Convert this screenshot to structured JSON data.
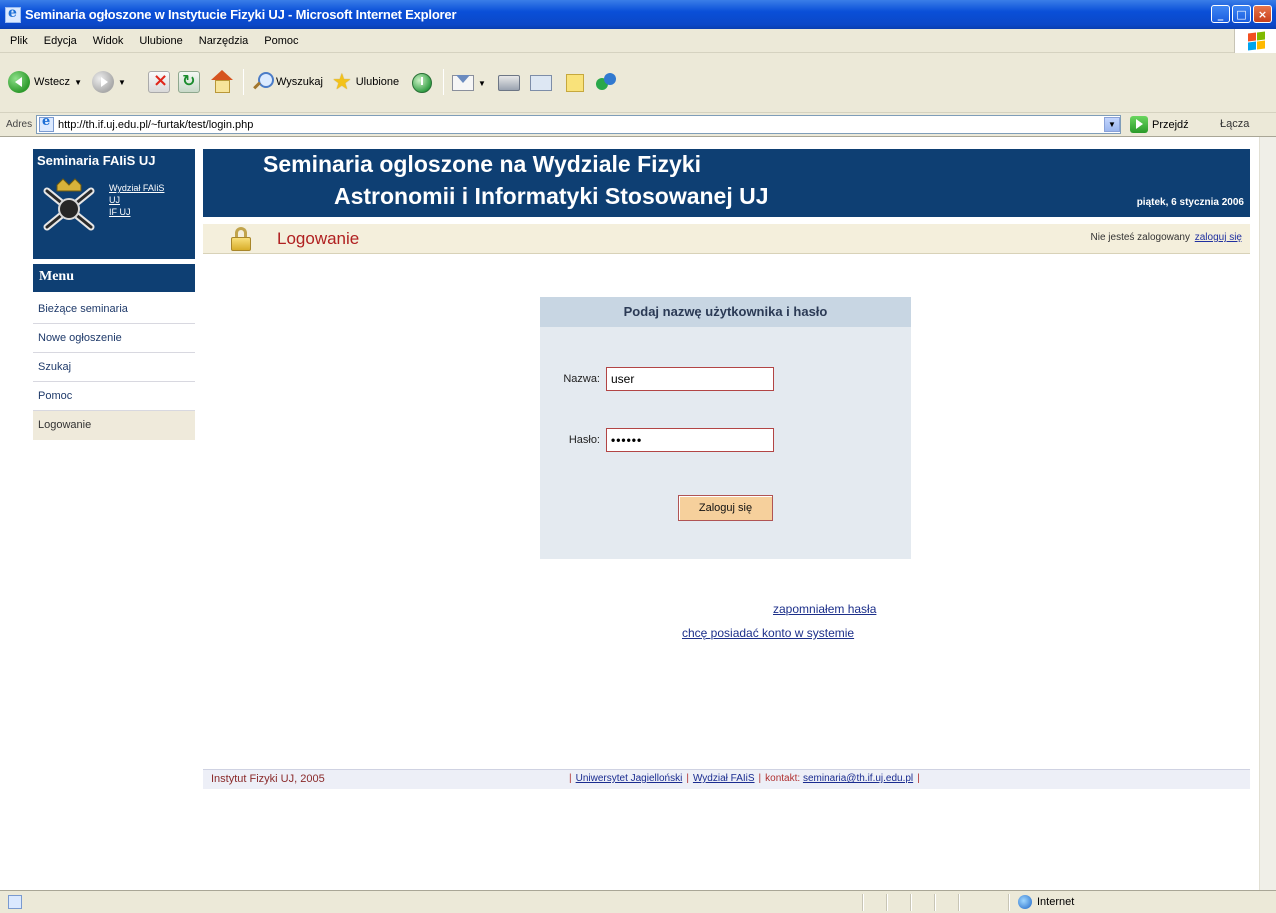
{
  "window": {
    "title": "Seminaria ogłoszone w Instytucie Fizyki UJ - Microsoft Internet Explorer",
    "controls": [
      "_",
      "□",
      "×"
    ]
  },
  "menubar": [
    "Plik",
    "Edycja",
    "Widok",
    "Ulubione",
    "Narzędzia",
    "Pomoc"
  ],
  "toolbar": {
    "back_label": "Wstecz",
    "search_label": "Wyszukaj",
    "favorites_label": "Ulubione"
  },
  "addressbar": {
    "label": "Adres",
    "url": "http://th.if.uj.edu.pl/~furtak/test/login.php",
    "go_label": "Przejdź",
    "links_label": "Łącza"
  },
  "sidebar": {
    "brand_title": "Seminaria FAIiS UJ",
    "brand_links": [
      "Wydział FAIiS",
      "UJ",
      "IF UJ"
    ],
    "menu_title": "Menu",
    "items": [
      {
        "label": "Bieżące seminaria",
        "active": false
      },
      {
        "label": "Nowe ogłoszenie",
        "active": false
      },
      {
        "label": "Szukaj",
        "active": false
      },
      {
        "label": "Pomoc",
        "active": false
      },
      {
        "label": "Logowanie",
        "active": true
      }
    ]
  },
  "header": {
    "line1": "Seminaria ogloszone na Wydziale Fizyki",
    "line2": "Astronomii i Informatyki Stosowanej UJ",
    "date": "piątek, 6 stycznia 2006"
  },
  "subheader": {
    "title": "Logowanie",
    "status": "Nie jesteś zalogowany",
    "login_link": "zaloguj się"
  },
  "login": {
    "heading": "Podaj nazwę użytkownika i hasło",
    "username_label": "Nazwa:",
    "username_value": "user",
    "password_label": "Hasło:",
    "password_value": "••••••",
    "submit_label": "Zaloguj się"
  },
  "links": {
    "forgot": "zapomniałem hasła",
    "register": "chcę posiadać konto w systemie"
  },
  "footer": {
    "copyright": "Instytut Fizyki UJ, 2005",
    "sep": "|",
    "uj_link": "Uniwersytet Jagielloński",
    "faiis_link": "Wydział FAIiS",
    "contact_label": "kontakt:",
    "contact_email": "seminaria@th.if.uj.edu.pl"
  },
  "statusbar": {
    "zone": "Internet"
  },
  "colors": {
    "brand_navy": "#0e3f73",
    "accent_red": "#b02020",
    "panel_bg": "#e4eaf0"
  }
}
